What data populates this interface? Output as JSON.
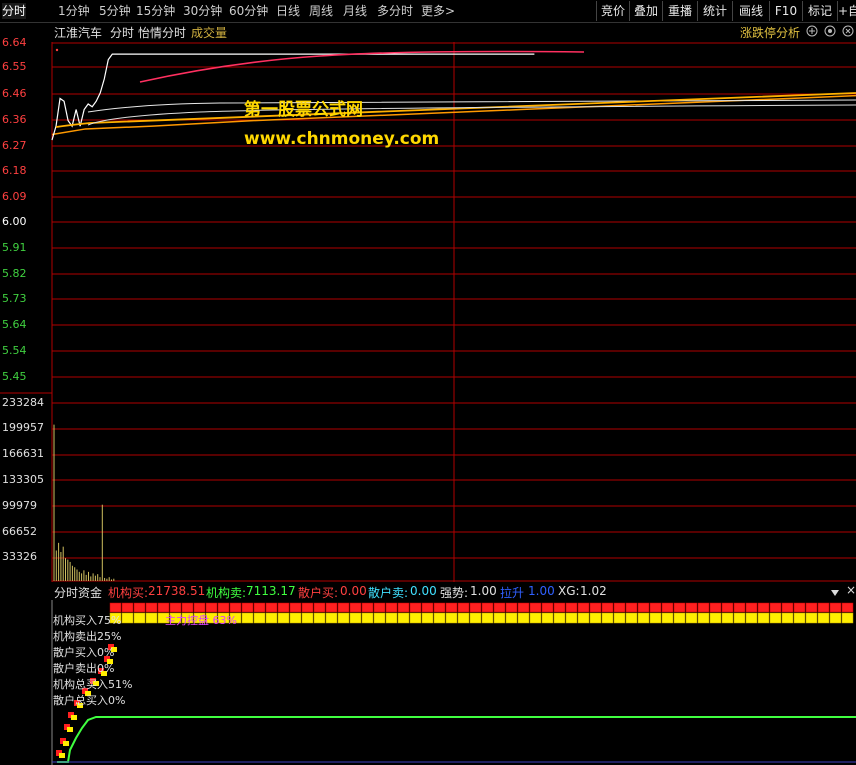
{
  "toolbar": {
    "periods": [
      "分时",
      "1分钟",
      "5分钟",
      "15分钟",
      "30分钟",
      "60分钟",
      "日线",
      "周线",
      "月线",
      "多分时",
      "更多"
    ],
    "more_arrow": ">",
    "right_buttons": [
      "竞价",
      "叠加",
      "重播",
      "统计",
      "画线",
      "F10",
      "标记",
      "+自"
    ]
  },
  "title": {
    "stock_name": "江淮汽车",
    "chart_mode": "分时",
    "indicator_name": "怡情分时",
    "volume_label": "成交量",
    "analysis_btn": "涨跌停分析"
  },
  "price_axis": [
    "6.64",
    "6.55",
    "6.46",
    "6.36",
    "6.27",
    "6.18",
    "6.09",
    "6.00",
    "5.91",
    "5.82",
    "5.73",
    "5.64",
    "5.54",
    "5.45"
  ],
  "volume_axis": [
    "233284",
    "199957",
    "166631",
    "133305",
    "99979",
    "66652",
    "33326"
  ],
  "watermark": {
    "line1": "第一股票公式网",
    "line2": "www.chnmoney.com"
  },
  "indicator": {
    "name": "分时资金",
    "inst_buy_label": "机构买:",
    "inst_buy_value": "21738.51",
    "inst_sell_label": "机构卖:",
    "inst_sell_value": "7113.17",
    "retail_buy_label": "散户买:",
    "retail_buy_value": "0.00",
    "retail_sell_label": "散户卖:",
    "retail_sell_value": "0.00",
    "strength_label": "强势:",
    "strength_value": "1.00",
    "pull_label": "拉升",
    "pull_value": "1.00",
    "xg_label": "XG:",
    "xg_value": "1.02",
    "rows": [
      "机构买入75%",
      "机构卖出25%",
      "散户买入0%",
      "散户卖出0%",
      "机构总买入51%",
      "散户总买入0%"
    ],
    "overlay_text": "主力控盘 63%"
  },
  "colors": {
    "grid": "#b00000",
    "price_red": "#ff4040",
    "price_green": "#40d040",
    "price_line": "#ffffff",
    "avg_line": "#ff9900",
    "volume": "#d0c060",
    "inst_buy": "#ff3030",
    "inst_sell": "#40ff40",
    "retail": "#40e0ff",
    "watermark": "#ffd800"
  },
  "chart_data": {
    "type": "line",
    "title": "",
    "price_series": [
      {
        "t": 0,
        "price": 6.29
      },
      {
        "t": 2,
        "price": 6.34
      },
      {
        "t": 4,
        "price": 6.44
      },
      {
        "t": 6,
        "price": 6.43
      },
      {
        "t": 8,
        "price": 6.36
      },
      {
        "t": 10,
        "price": 6.34
      },
      {
        "t": 12,
        "price": 6.4
      },
      {
        "t": 14,
        "price": 6.34
      },
      {
        "t": 16,
        "price": 6.4
      },
      {
        "t": 18,
        "price": 6.42
      },
      {
        "t": 20,
        "price": 6.41
      },
      {
        "t": 22,
        "price": 6.43
      },
      {
        "t": 24,
        "price": 6.46
      },
      {
        "t": 26,
        "price": 6.51
      },
      {
        "t": 28,
        "price": 6.58
      },
      {
        "t": 30,
        "price": 6.6
      },
      {
        "t": 60,
        "price": 6.6
      },
      {
        "t": 120,
        "price": 6.6
      },
      {
        "t": 180,
        "price": 6.6
      },
      {
        "t": 240,
        "price": 6.6
      }
    ],
    "average_series": [
      {
        "t": 0,
        "price": 6.31
      },
      {
        "t": 10,
        "price": 6.33
      },
      {
        "t": 30,
        "price": 6.34
      },
      {
        "t": 60,
        "price": 6.36
      },
      {
        "t": 100,
        "price": 6.38
      },
      {
        "t": 140,
        "price": 6.4
      },
      {
        "t": 180,
        "price": 6.42
      },
      {
        "t": 220,
        "price": 6.44
      },
      {
        "t": 240,
        "price": 6.45
      }
    ],
    "ylim": [
      5.41,
      6.64
    ],
    "volume_ylim": [
      0,
      233284
    ]
  }
}
